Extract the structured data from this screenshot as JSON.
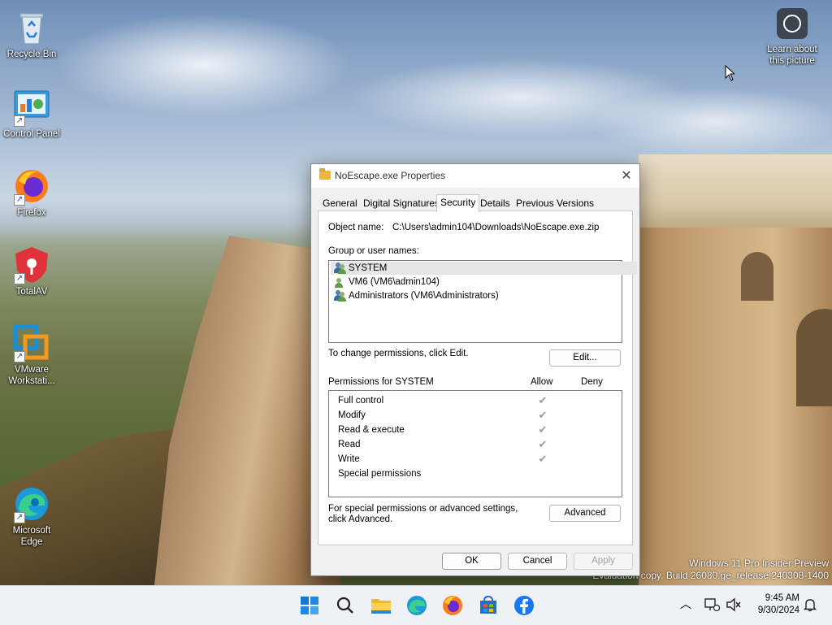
{
  "desktop": {
    "icons": [
      {
        "label": "Recycle Bin",
        "icon": "recycle-bin-icon"
      },
      {
        "label": "Control Panel",
        "icon": "control-panel-icon"
      },
      {
        "label": "Firefox",
        "icon": "firefox-icon"
      },
      {
        "label": "TotalAV",
        "icon": "totalav-icon"
      },
      {
        "label": "VMware Workstati...",
        "icon": "vmware-icon"
      },
      {
        "label": "Microsoft Edge",
        "icon": "edge-icon"
      }
    ],
    "learn_about": "Learn about this picture",
    "watermark_line1": "Windows 11 Pro Insider Preview",
    "watermark_line2": "Evaluation copy. Build 26080.ge_release.240308-1400"
  },
  "dialog": {
    "title": "NoEscape.exe Properties",
    "close": "✕",
    "tabs": [
      "General",
      "Digital Signatures",
      "Security",
      "Details",
      "Previous Versions"
    ],
    "active_tab": "Security",
    "object_name_label": "Object name:",
    "object_name_value": "C:\\Users\\admin104\\Downloads\\NoEscape.exe.zip",
    "group_label": "Group or user names:",
    "users": [
      "SYSTEM",
      "VM6 (VM6\\admin104)",
      "Administrators (VM6\\Administrators)"
    ],
    "selected_user": "SYSTEM",
    "change_perm_text": "To change permissions, click Edit.",
    "edit_button": "Edit...",
    "permissions_for": "Permissions for SYSTEM",
    "allow_header": "Allow",
    "deny_header": "Deny",
    "permissions": [
      {
        "name": "Full control",
        "allow": true,
        "deny": false
      },
      {
        "name": "Modify",
        "allow": true,
        "deny": false
      },
      {
        "name": "Read & execute",
        "allow": true,
        "deny": false
      },
      {
        "name": "Read",
        "allow": true,
        "deny": false
      },
      {
        "name": "Write",
        "allow": true,
        "deny": false
      },
      {
        "name": "Special permissions",
        "allow": false,
        "deny": false
      }
    ],
    "special_text": "For special permissions or advanced settings, click Advanced.",
    "advanced_button": "Advanced",
    "ok_button": "OK",
    "cancel_button": "Cancel",
    "apply_button": "Apply"
  },
  "taskbar": {
    "apps": [
      "start-icon",
      "search-icon",
      "file-explorer-icon",
      "edge-icon",
      "firefox-icon",
      "store-icon",
      "facebook-icon"
    ],
    "time": "9:45 AM",
    "date": "9/30/2024"
  },
  "colors": {
    "accent": "#0067c0",
    "dialog_bg": "#f0f0f0",
    "taskbar_bg": "#eef1f6"
  }
}
